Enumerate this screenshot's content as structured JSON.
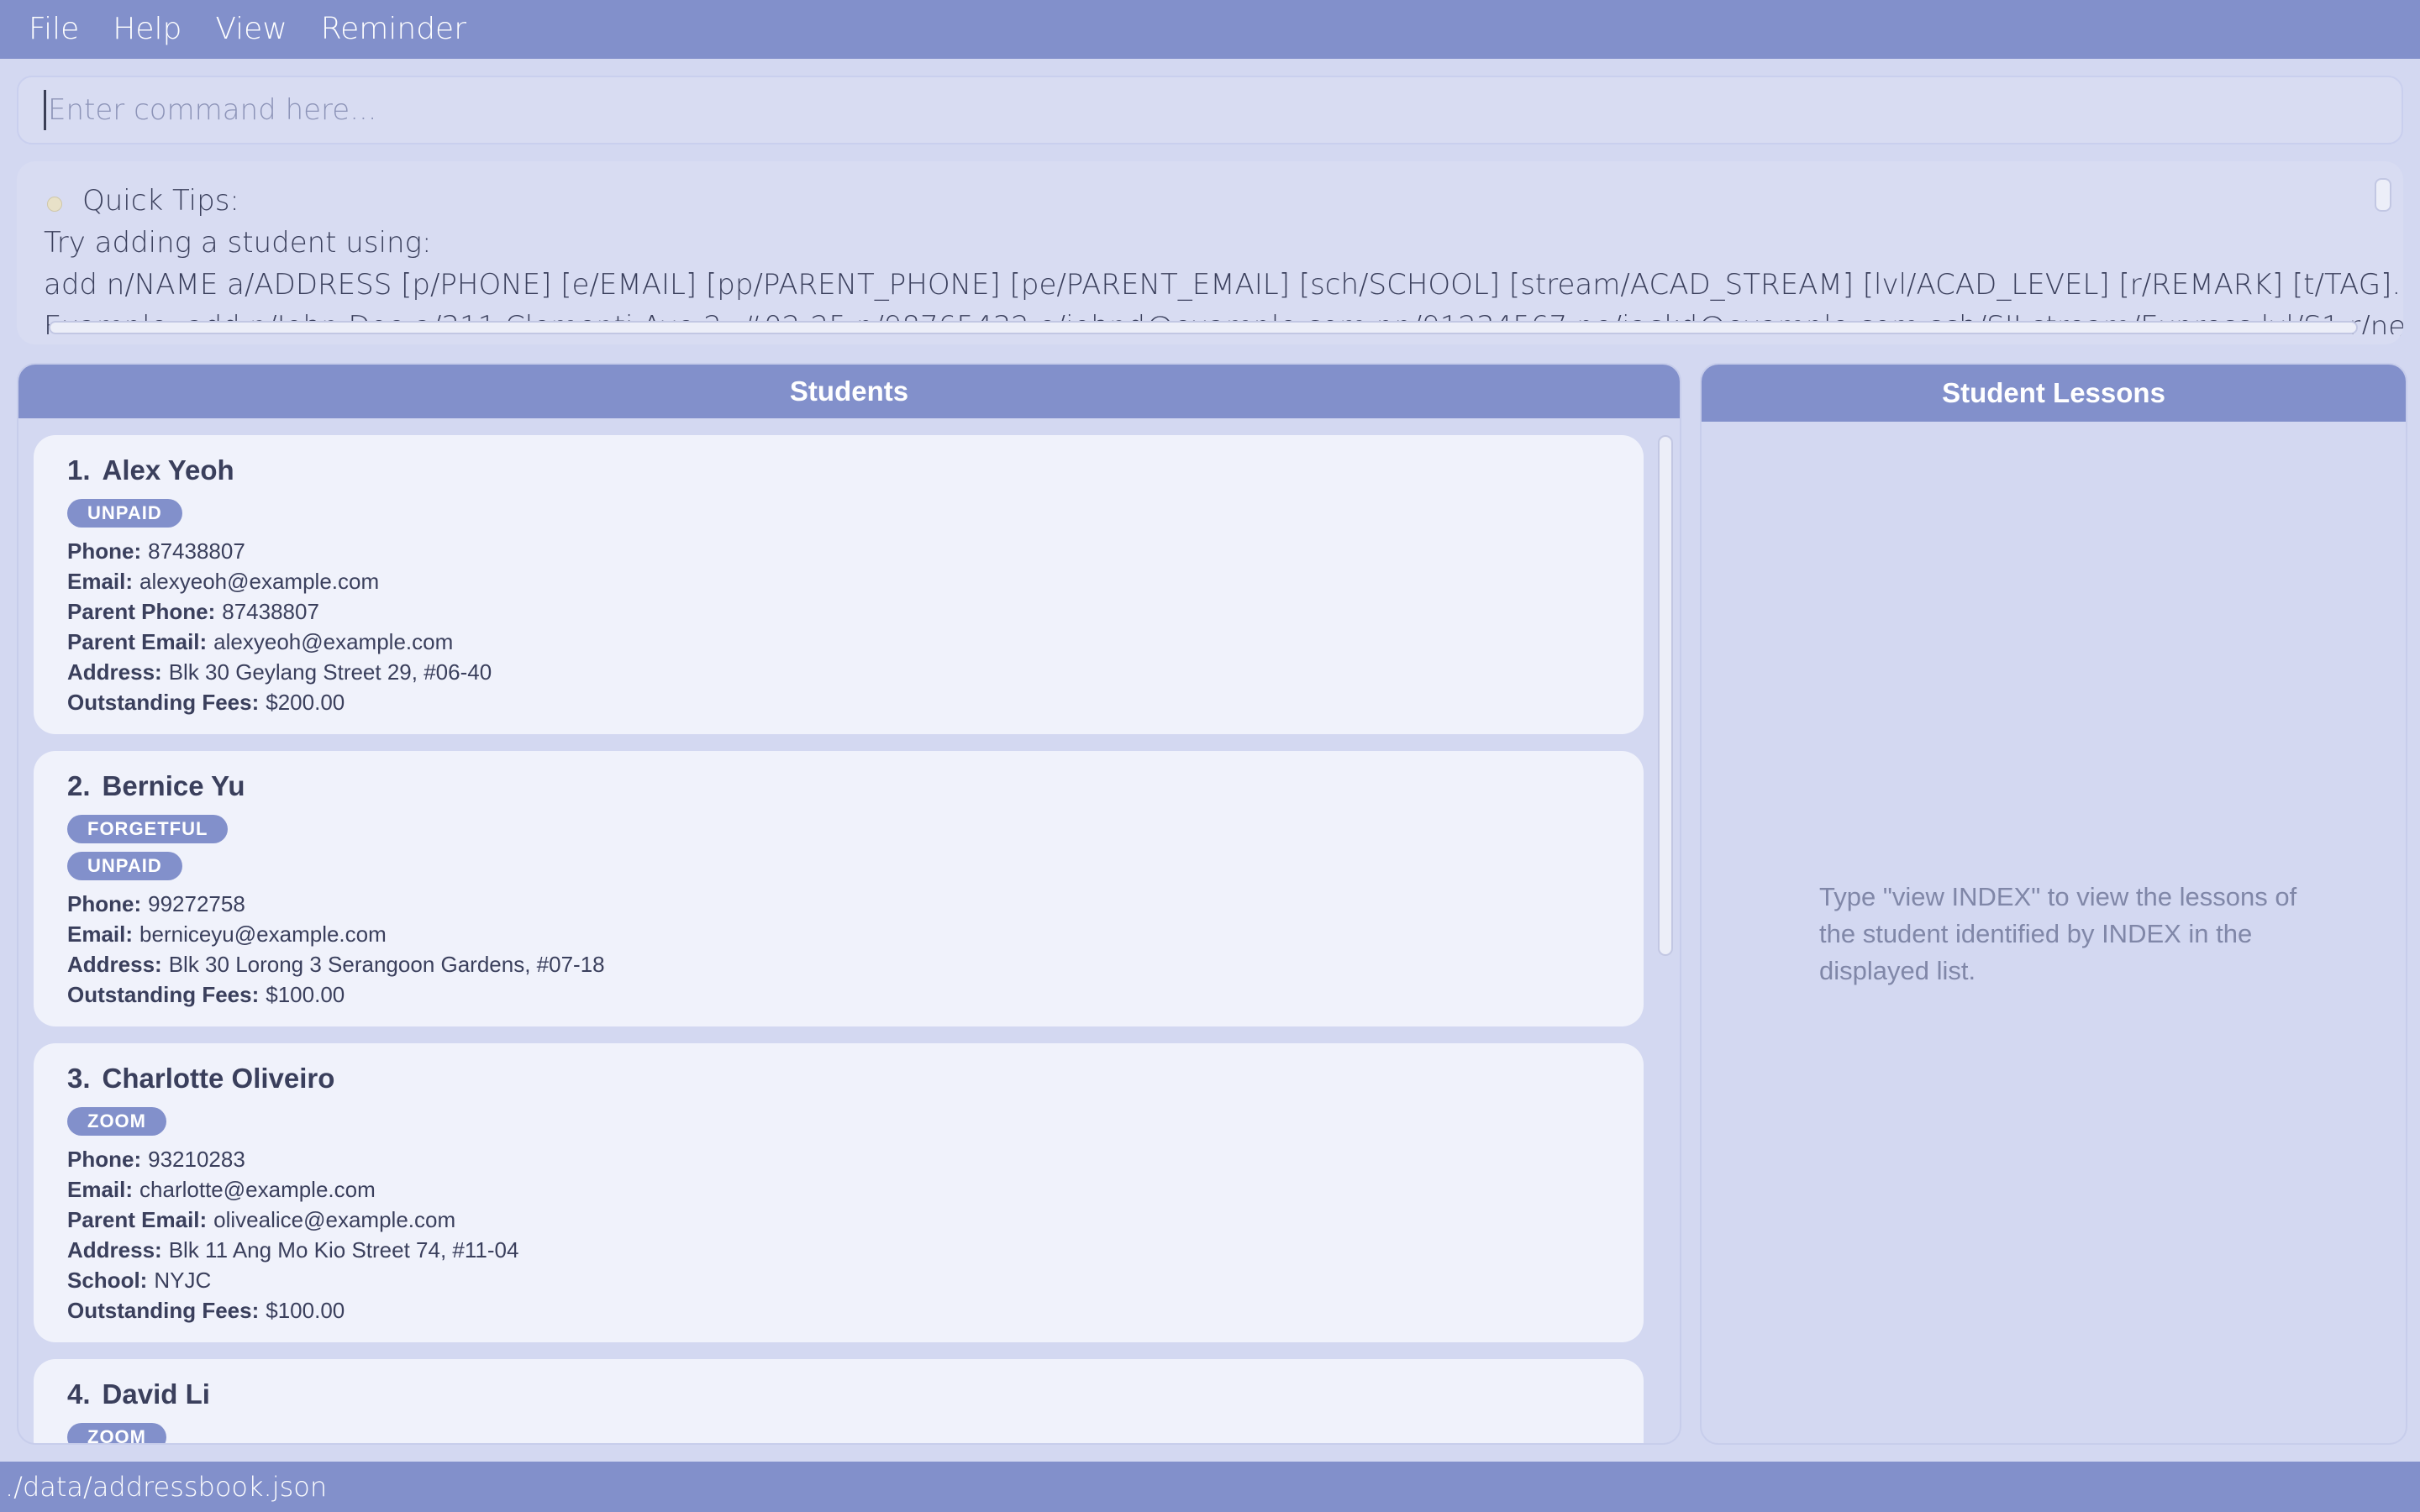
{
  "menu": {
    "items": [
      {
        "label": "File"
      },
      {
        "label": "Help"
      },
      {
        "label": "View"
      },
      {
        "label": "Reminder"
      }
    ]
  },
  "command": {
    "placeholder": "Enter command here...",
    "value": ""
  },
  "result": {
    "tips_title": "Quick Tips:",
    "line1": "Try adding a student using:",
    "line2": "add n/NAME a/ADDRESS [p/PHONE] [e/EMAIL] [pp/PARENT_PHONE] [pe/PARENT_EMAIL] [sch/SCHOOL] [stream/ACAD_STREAM] [lvl/ACAD_LEVEL] [r/REMARK] [t/TAG]...",
    "line3": "Example: add n/John Doe a/311 Clementi Ave 2, #02-25 p/98765432 e/johnd@example.com pp/91234567 pe/jackd@example.com sch/SJI stream/Express lvl/S1 r/needs tuition t/extra"
  },
  "students_panel": {
    "title": "Students",
    "students": [
      {
        "index": "1.",
        "name": "Alex Yeoh",
        "tags": [
          "UNPAID"
        ],
        "fields": [
          {
            "label": "Phone:",
            "value": "87438807"
          },
          {
            "label": "Email:",
            "value": "alexyeoh@example.com"
          },
          {
            "label": "Parent Phone:",
            "value": "87438807"
          },
          {
            "label": "Parent Email:",
            "value": "alexyeoh@example.com"
          },
          {
            "label": "Address:",
            "value": "Blk 30 Geylang Street 29, #06-40"
          },
          {
            "label": "Outstanding Fees:",
            "value": "$200.00"
          }
        ]
      },
      {
        "index": "2.",
        "name": "Bernice Yu",
        "tags": [
          "FORGETFUL",
          "UNPAID"
        ],
        "fields": [
          {
            "label": "Phone:",
            "value": "99272758"
          },
          {
            "label": "Email:",
            "value": "berniceyu@example.com"
          },
          {
            "label": "Address:",
            "value": "Blk 30 Lorong 3 Serangoon Gardens, #07-18"
          },
          {
            "label": "Outstanding Fees:",
            "value": "$100.00"
          }
        ]
      },
      {
        "index": "3.",
        "name": "Charlotte Oliveiro",
        "tags": [
          "ZOOM"
        ],
        "fields": [
          {
            "label": "Phone:",
            "value": "93210283"
          },
          {
            "label": "Email:",
            "value": "charlotte@example.com"
          },
          {
            "label": "Parent Email:",
            "value": "olivealice@example.com"
          },
          {
            "label": "Address:",
            "value": "Blk 11 Ang Mo Kio Street 74, #11-04"
          },
          {
            "label": "School:",
            "value": "NYJC"
          },
          {
            "label": "Outstanding Fees:",
            "value": "$100.00"
          }
        ]
      },
      {
        "index": "4.",
        "name": "David Li",
        "tags": [
          "ZOOM"
        ],
        "fields": []
      }
    ]
  },
  "lessons_panel": {
    "title": "Student Lessons",
    "hint": "Type \"view INDEX\" to view the lessons of the student identified by INDEX in the displayed list."
  },
  "status": {
    "path": "./data/addressbook.json"
  },
  "colors": {
    "accent": "#8290cb",
    "background": "#d3d8f1",
    "card": "#f0f2fb"
  }
}
